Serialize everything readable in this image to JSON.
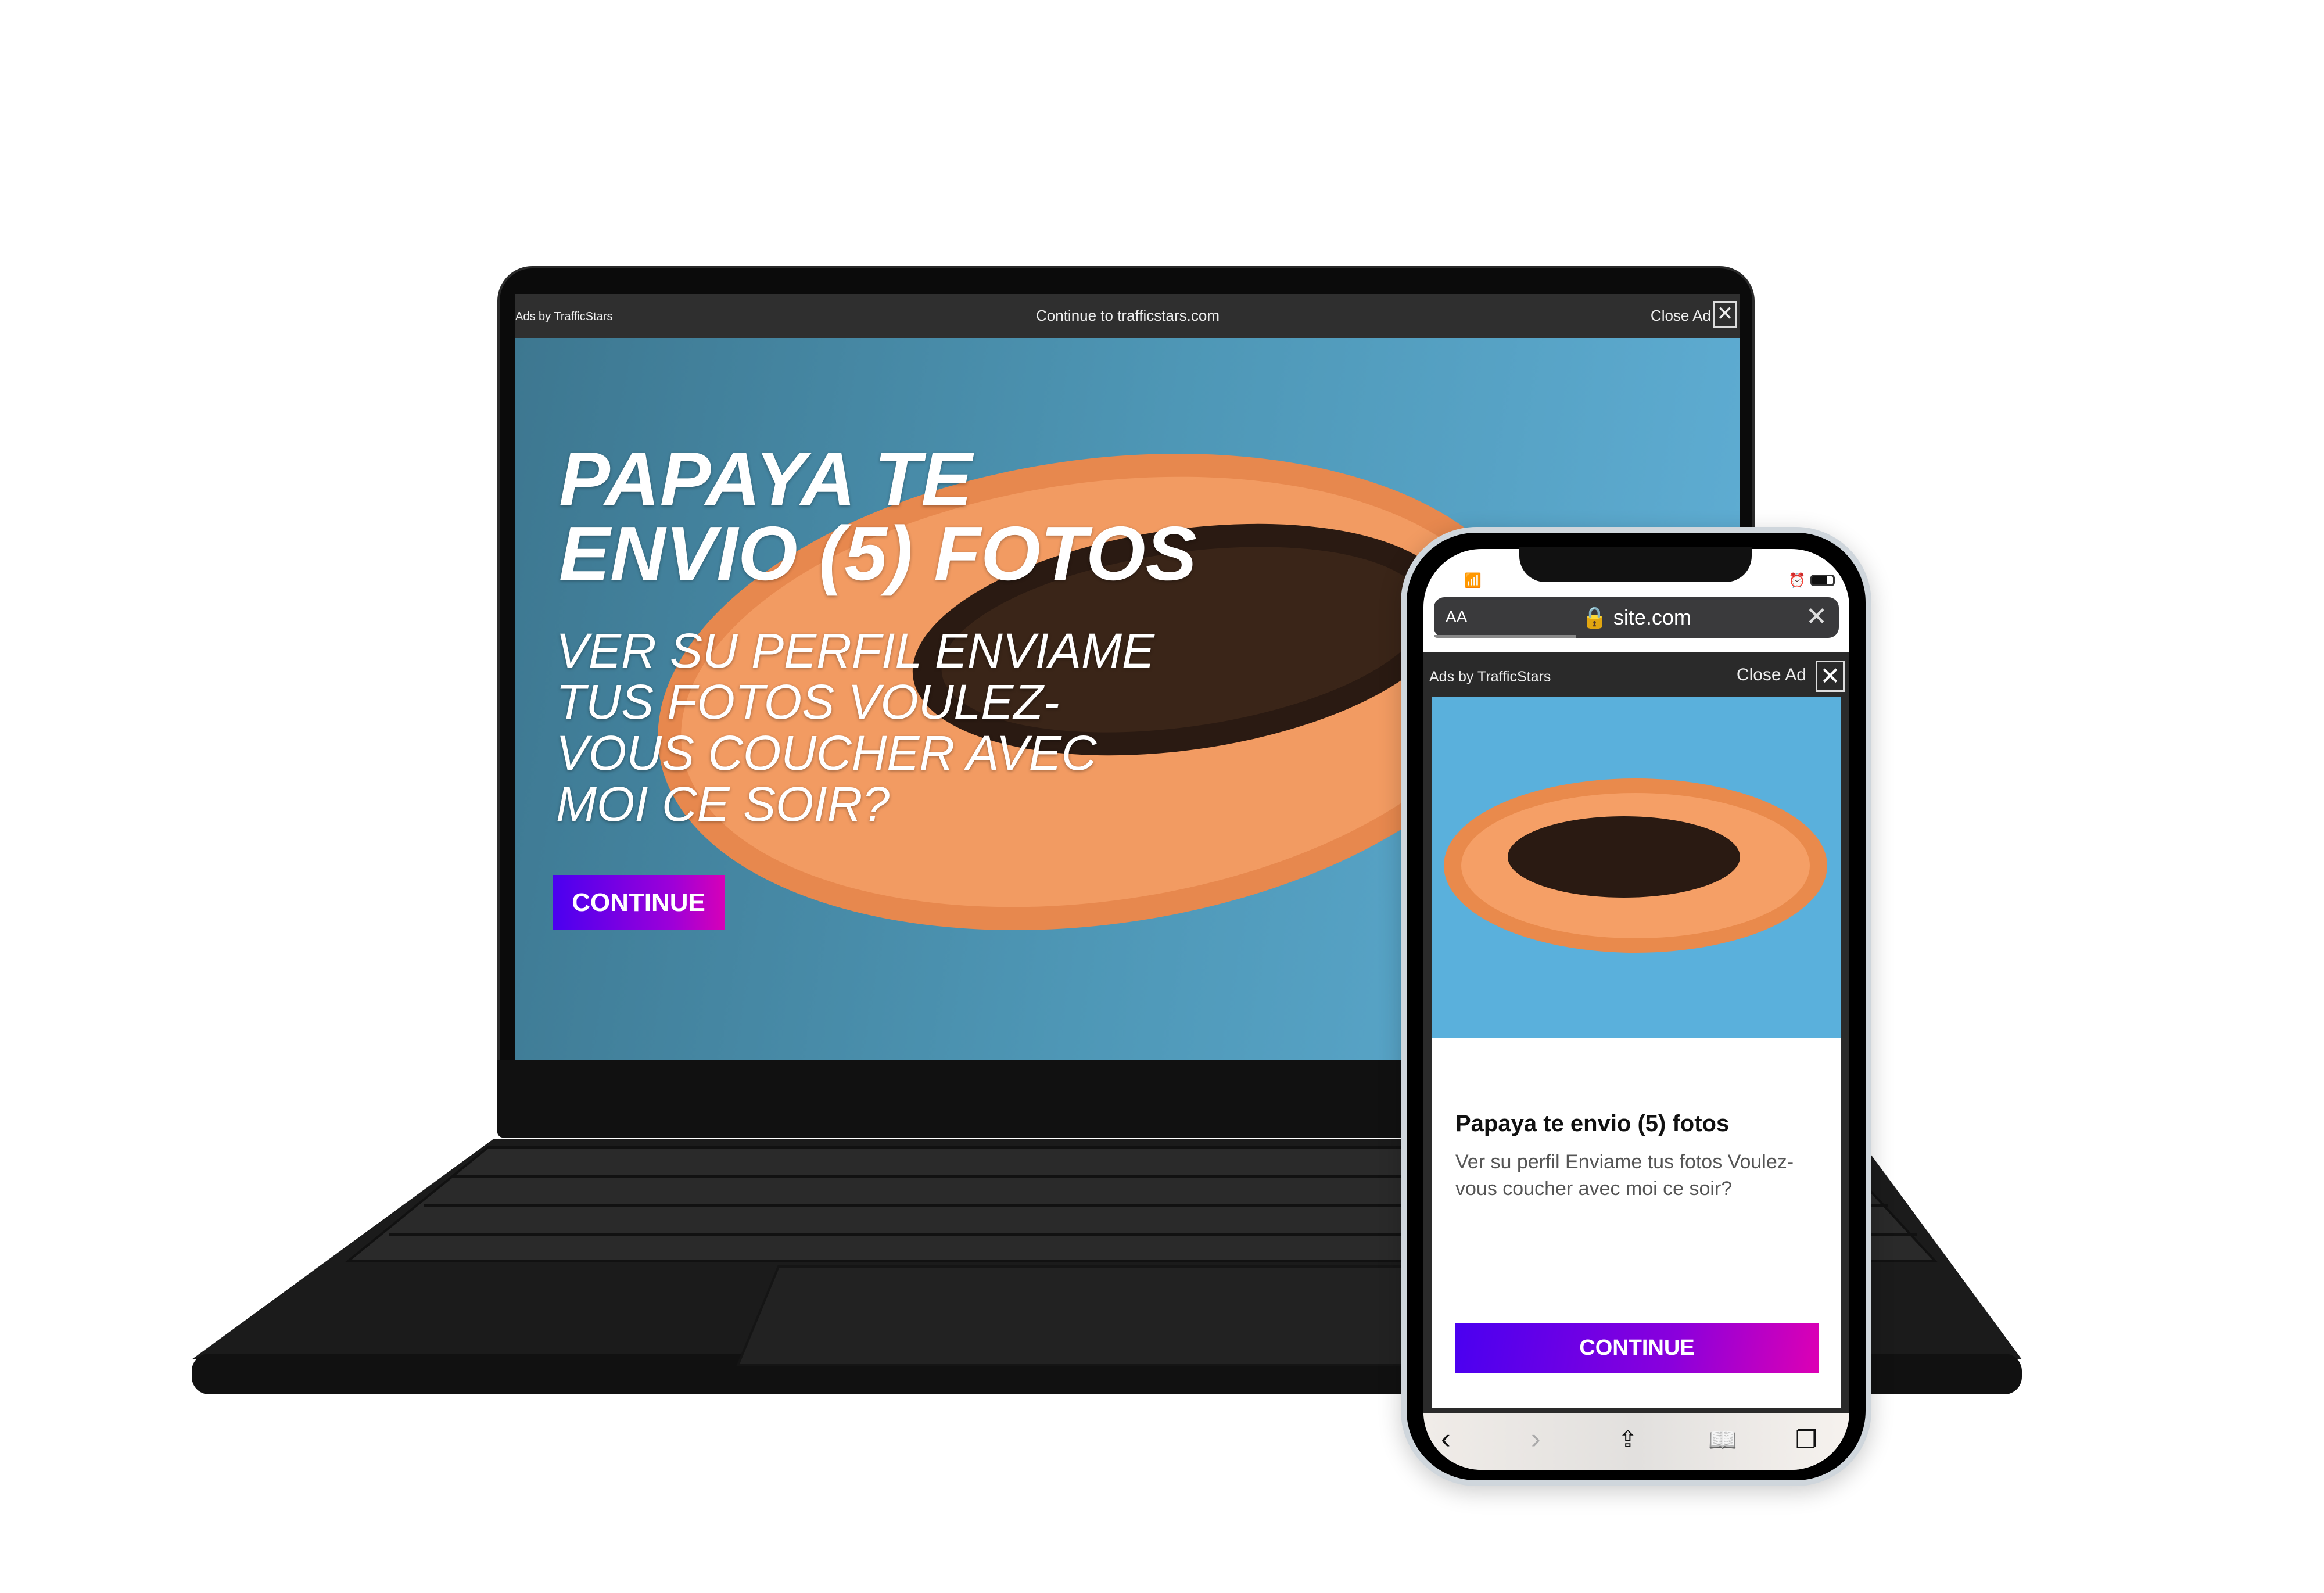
{
  "laptop": {
    "ad_bar": {
      "ads_by": "Ads by TrafficStars",
      "continue_link": "Continue to trafficstars.com",
      "close_ad": "Close Ad",
      "close_icon": "✕"
    },
    "ad": {
      "headline_line1": "PAPAYA TE",
      "headline_line2": "ENVIO (5) FOTOS",
      "subtitle": "VER SU PERFIL ENVIAME TUS FOTOS VOULEZ-VOUS COUCHER AVEC MOI CE SOIR?",
      "cta": "CONTINUE"
    }
  },
  "phone": {
    "status": {
      "wifi_icon": "wifi",
      "alarm_icon": "alarm",
      "battery_icon": "battery"
    },
    "url_bar": {
      "text_size": "AA",
      "url": "site.com",
      "close": "✕"
    },
    "ad_bar": {
      "ads_by": "Ads by TrafficStars",
      "close_ad": "Close Ad",
      "close_icon": "✕"
    },
    "ad": {
      "title": "Papaya te envio (5) fotos",
      "body": "Ver su perfil Enviame tus fotos Voulez-vous coucher avec moi ce soir?",
      "cta": "CONTINUE"
    },
    "toolbar": {
      "back": "‹",
      "forward": "›",
      "share": "⇪",
      "bookmarks": "📖",
      "tabs": "❐"
    }
  },
  "colors": {
    "cta_start": "#4a00f0",
    "cta_end": "#d600b8",
    "ad_bar": "#2f2f2f"
  }
}
